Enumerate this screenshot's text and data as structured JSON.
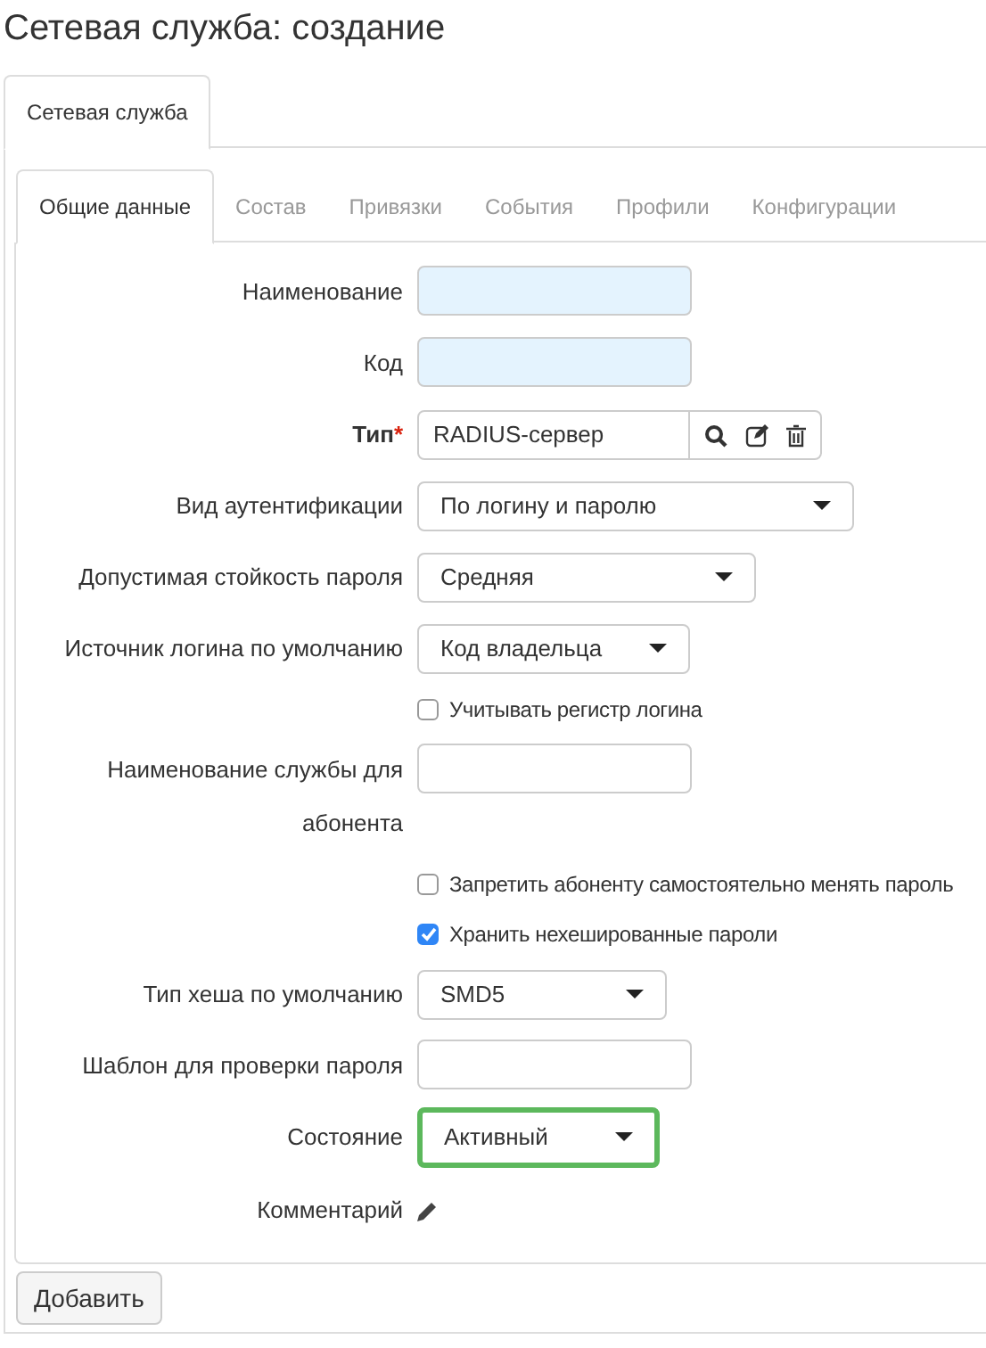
{
  "title": "Сетевая служба: создание",
  "outer_tabs": [
    {
      "label": "Сетевая служба",
      "selected": true
    }
  ],
  "inner_tabs": [
    {
      "label": "Общие данные",
      "selected": true
    },
    {
      "label": "Состав",
      "selected": false
    },
    {
      "label": "Привязки",
      "selected": false
    },
    {
      "label": "События",
      "selected": false
    },
    {
      "label": "Профили",
      "selected": false
    },
    {
      "label": "Конфигурации",
      "selected": false
    }
  ],
  "fields": [
    {
      "kind": "text",
      "label": "Наименование",
      "highlighted": true
    },
    {
      "kind": "text",
      "label": "Код",
      "highlighted": true
    },
    {
      "kind": "lookup",
      "label": "Тип",
      "required": true,
      "required_mark": "*",
      "value": "RADIUS-сервер"
    },
    {
      "kind": "select",
      "label": "Вид аутентификации",
      "value": "По логину и паролю",
      "focused": false
    },
    {
      "kind": "select",
      "label": "Допустимая стойкость пароля",
      "value": "Средняя",
      "focused": false
    },
    {
      "kind": "select",
      "label": "Источник логина по умолчанию",
      "value": "Код владельца",
      "focused": false
    },
    {
      "kind": "checkbox",
      "label": "Учитывать регистр логина",
      "checked": false
    },
    {
      "kind": "text",
      "label": "Наименование службы для абонента",
      "highlighted": false
    },
    {
      "kind": "checkbox",
      "label": "Запретить абоненту самостоятельно менять пароль",
      "checked": false
    },
    {
      "kind": "checkbox",
      "label": "Хранить нехешированные пароли",
      "checked": true
    },
    {
      "kind": "select",
      "label": "Тип хеша по умолчанию",
      "value": "SMD5",
      "focused": false
    },
    {
      "kind": "text",
      "label": "Шаблон для проверки пароля",
      "highlighted": false
    },
    {
      "kind": "select",
      "label": "Состояние",
      "value": "Активный",
      "focused": true
    },
    {
      "kind": "comment",
      "label": "Комментарий"
    }
  ],
  "button": "Добавить"
}
